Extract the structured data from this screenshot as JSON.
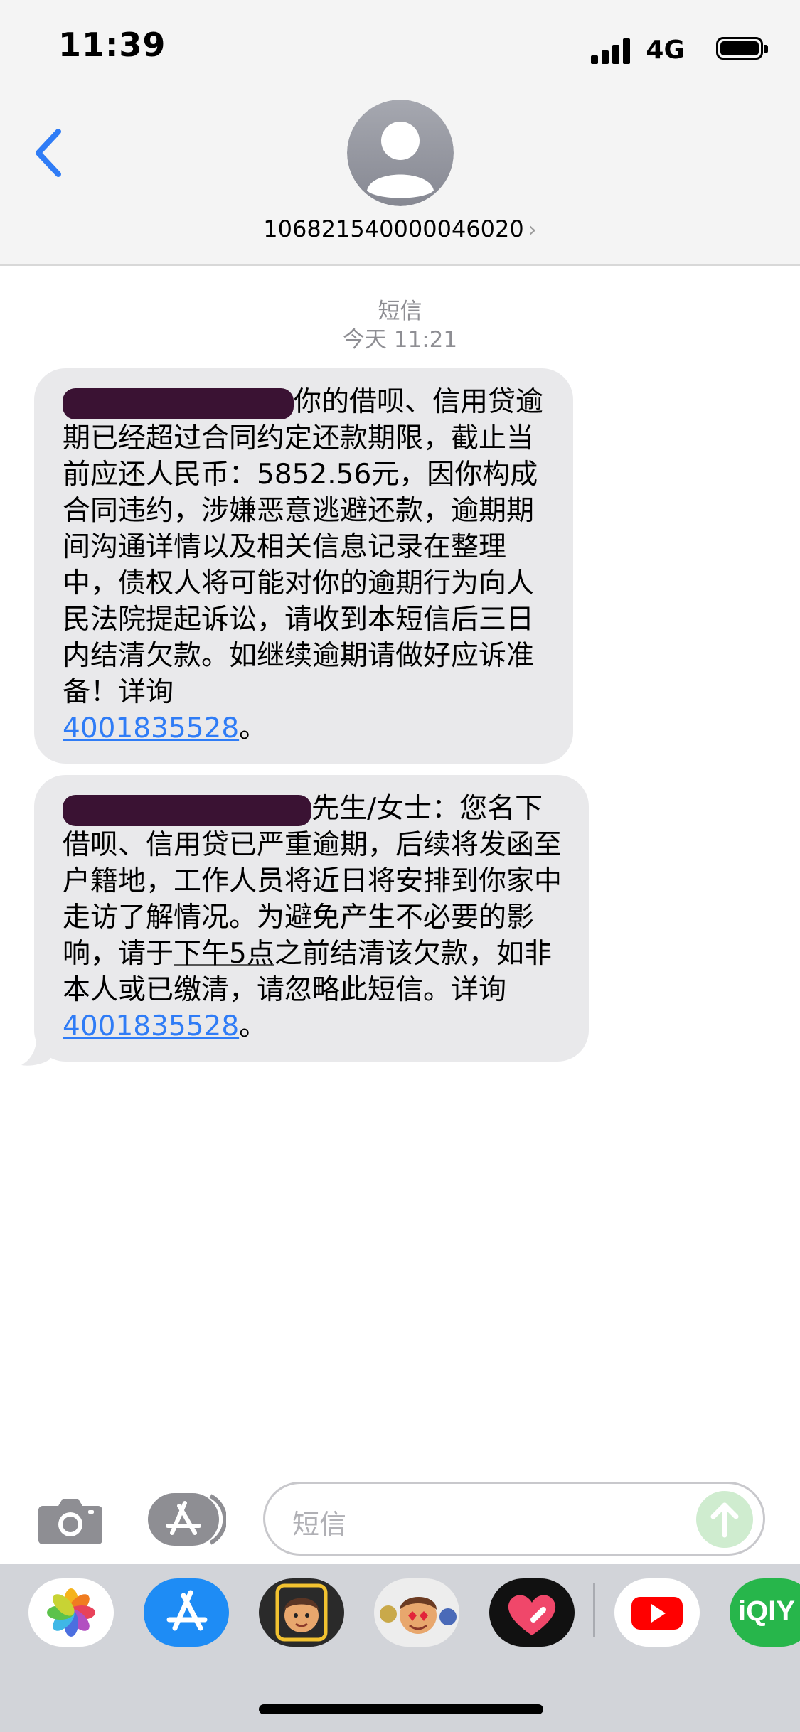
{
  "status_bar": {
    "time": "11:39",
    "network": "4G"
  },
  "header": {
    "contact_number": "106821540000046020",
    "chevron": "›"
  },
  "conversation": {
    "service_label": "短信",
    "timestamp": "今天 11:21",
    "messages": [
      {
        "text_before_link": "你的借呗、信用贷逾期已经超过合同约定还款期限，截止当前应还人民币：5852.56元，因你构成合同违约，涉嫌恶意逃避还款，逾期期间沟通详情以及相关信息记录在整理中，债权人将可能对你的逾期行为向人民法院提起诉讼，请收到本短信后三日内结清欠款。如继续逾期请做好应诉准备！详询",
        "link": "4001835528",
        "text_after_link": "。"
      },
      {
        "text_before_underline": "先生/女士：您名下借呗、信用贷已严重逾期，后续将发函至户籍地，工作人员将近日将安排到你家中走访了解情况。为避免产生不必要的影响，请于",
        "underlined": "下午5点",
        "text_before_link": "之前结清该欠款，如非本人或已缴清，请忽略此短信。详询",
        "link": "4001835528",
        "text_after_link": "。"
      }
    ]
  },
  "compose": {
    "placeholder": "短信"
  },
  "app_drawer": {
    "apps": [
      "photos-icon",
      "app-store-icon",
      "memoji-icon",
      "memoji-stickers-icon",
      "heart-app-icon",
      "youtube-icon",
      "iqiyi-icon"
    ],
    "iqiyi_label": "iQIY"
  },
  "colors": {
    "bubble": "#e9e9eb",
    "link": "#2f7cf6",
    "accent": "#2f7cf6"
  }
}
